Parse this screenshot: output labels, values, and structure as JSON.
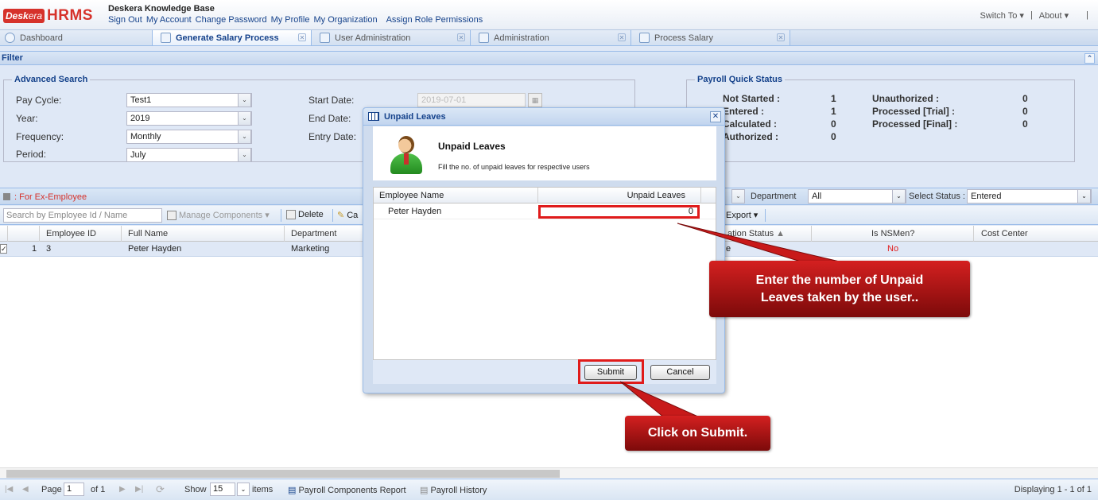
{
  "header": {
    "logo_left": "Desk",
    "logo_mid": "era",
    "logo_right": "HRMS",
    "kb_title": "Deskera Knowledge Base",
    "links": [
      "Sign Out",
      "My Account",
      "Change Password",
      "My Profile",
      "My Organization",
      "Assign Role Permissions"
    ],
    "switch_to": "Switch To",
    "about": "About"
  },
  "tabs": [
    {
      "label": "Dashboard"
    },
    {
      "label": "Generate Salary Process"
    },
    {
      "label": "User Administration"
    },
    {
      "label": "Administration"
    },
    {
      "label": "Process Salary"
    }
  ],
  "filter": {
    "title": "Filter",
    "advanced_search": {
      "legend": "Advanced Search",
      "pay_cycle_label": "Pay Cycle:",
      "pay_cycle_value": "Test1",
      "year_label": "Year:",
      "year_value": "2019",
      "frequency_label": "Frequency:",
      "frequency_value": "Monthly",
      "period_label": "Period:",
      "period_value": "July",
      "start_date_label": "Start Date:",
      "start_date_value": "2019-07-01",
      "end_date_label": "End Date:",
      "entry_date_label": "Entry Date:"
    },
    "quick_status": {
      "legend": "Payroll Quick Status",
      "not_started_label": "Not Started :",
      "not_started_value": "1",
      "entered_label": "Entered :",
      "entered_value": "1",
      "calculated_label": "Calculated :",
      "calculated_value": "0",
      "authorized_label": "Authorized :",
      "authorized_value": "0",
      "unauthorized_label": "Unauthorized :",
      "unauthorized_value": "0",
      "processed_trial_label": "Processed [Trial] :",
      "processed_trial_value": "0",
      "processed_final_label": "Processed [Final] :",
      "processed_final_value": "0"
    }
  },
  "grid": {
    "ex_employee_label": ": For Ex-Employee",
    "search_placeholder": "Search by Employee Id / Name",
    "manage_components": "Manage Components",
    "delete": "Delete",
    "ca_partial": "Ca",
    "department_label": "Department",
    "department_value": "All",
    "select_status_label": "Select Status :",
    "select_status_value": "Entered",
    "export": "Export",
    "columns": {
      "employee_id": "Employee ID",
      "full_name": "Full Name",
      "department": "Department",
      "ation_status": "ation Status",
      "is_nsmen": "Is NSMen?",
      "cost_center": "Cost Center"
    },
    "rows": [
      {
        "num": "1",
        "employee_id": "3",
        "full_name": "Peter Hayden",
        "department": "Marketing",
        "status_partial": "e",
        "is_nsmen": "No"
      }
    ]
  },
  "pager": {
    "page_label": "Page",
    "page_value": "1",
    "of_label": "of 1",
    "show_label": "Show",
    "show_value": "15",
    "items_label": "items",
    "components_report": "Payroll Components Report",
    "payroll_history": "Payroll History",
    "displaying": "Displaying 1 - 1 of 1"
  },
  "modal": {
    "title": "Unpaid Leaves",
    "heading": "Unpaid Leaves",
    "subtitle": "Fill the no. of unpaid leaves for respective users",
    "col_name": "Employee Name",
    "col_leaves": "Unpaid Leaves",
    "rows": [
      {
        "name": "Peter Hayden",
        "leaves": "0"
      }
    ],
    "submit": "Submit",
    "cancel": "Cancel"
  },
  "callouts": {
    "leaves_line1": "Enter the number of Unpaid",
    "leaves_line2": "Leaves taken by the user..",
    "submit": "Click on Submit."
  },
  "colors": {
    "accent": "#15428b",
    "highlight": "#e01b1b",
    "callout": "#c41616"
  }
}
